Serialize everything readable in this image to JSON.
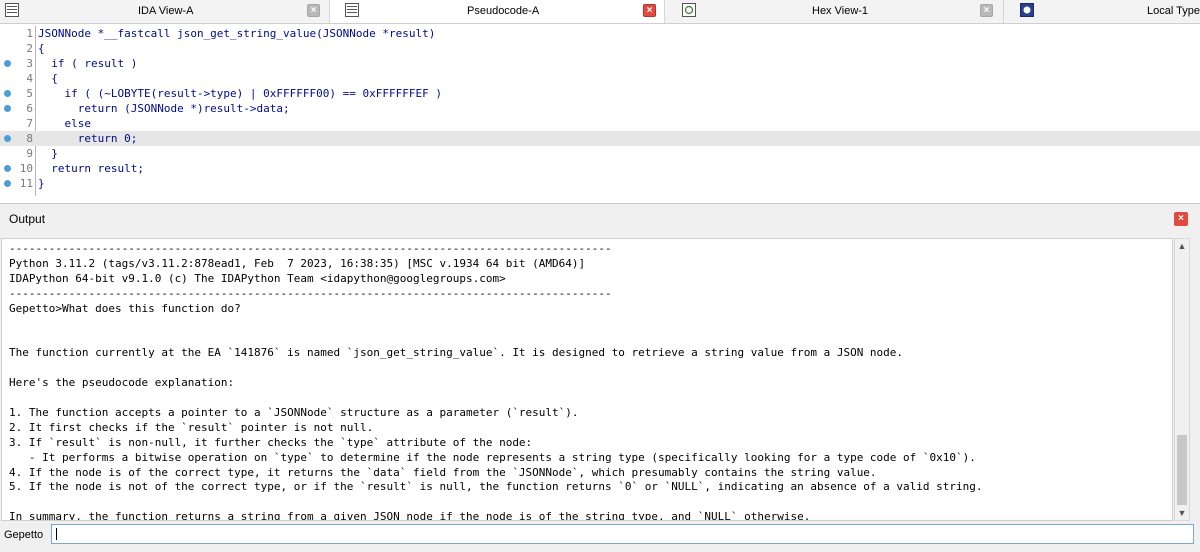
{
  "tabs": [
    {
      "label": "IDA View-A",
      "icon": "disassembly-icon",
      "active": false
    },
    {
      "label": "Pseudocode-A",
      "icon": "pseudocode-icon",
      "active": true
    },
    {
      "label": "Hex View-1",
      "icon": "hex-view-icon",
      "active": false
    },
    {
      "label": "Local Types",
      "icon": "local-types-icon",
      "active": false
    }
  ],
  "tab_close_glyph": "×",
  "code": {
    "lines": [
      {
        "num": "1",
        "breakpoint": false,
        "text": "JSONNode *__fastcall json_get_string_value(JSONNode *result)"
      },
      {
        "num": "2",
        "breakpoint": false,
        "text": "{"
      },
      {
        "num": "3",
        "breakpoint": true,
        "text": "  if ( result )"
      },
      {
        "num": "4",
        "breakpoint": false,
        "text": "  {"
      },
      {
        "num": "5",
        "breakpoint": true,
        "text": "    if ( (~LOBYTE(result->type) | 0xFFFFFF00) == 0xFFFFFFEF )"
      },
      {
        "num": "6",
        "breakpoint": true,
        "text": "      return (JSONNode *)result->data;"
      },
      {
        "num": "7",
        "breakpoint": false,
        "text": "    else"
      },
      {
        "num": "8",
        "breakpoint": true,
        "text": "      return 0;"
      },
      {
        "num": "9",
        "breakpoint": false,
        "text": "  }"
      },
      {
        "num": "10",
        "breakpoint": true,
        "text": "  return result;"
      },
      {
        "num": "11",
        "breakpoint": true,
        "text": "}"
      }
    ],
    "highlighted_line": "8"
  },
  "output": {
    "title": "Output",
    "close_glyph": "×",
    "lines": [
      "-------------------------------------------------------------------------------------------",
      "Python 3.11.2 (tags/v3.11.2:878ead1, Feb  7 2023, 16:38:35) [MSC v.1934 64 bit (AMD64)]",
      "IDAPython 64-bit v9.1.0 (c) The IDAPython Team <idapython@googlegroups.com>",
      "-------------------------------------------------------------------------------------------",
      "Gepetto>What does this function do?",
      "",
      "",
      "The function currently at the EA `141876` is named `json_get_string_value`. It is designed to retrieve a string value from a JSON node.",
      "",
      "Here's the pseudocode explanation:",
      "",
      "1. The function accepts a pointer to a `JSONNode` structure as a parameter (`result`).",
      "2. It first checks if the `result` pointer is not null.",
      "3. If `result` is non-null, it further checks the `type` attribute of the node:",
      "   - It performs a bitwise operation on `type` to determine if the node represents a string type (specifically looking for a type code of `0x10`).",
      "4. If the node is of the correct type, it returns the `data` field from the `JSONNode`, which presumably contains the string value.",
      "5. If the node is not of the correct type, or if the `result` is null, the function returns `0` or `NULL`, indicating an absence of a valid string.",
      "",
      "In summary, the function returns a string from a given JSON node if the node is of the string type, and `NULL` otherwise."
    ]
  },
  "cli": {
    "label": "Gepetto",
    "value": ""
  },
  "colors": {
    "accent_close": "#e04a3f",
    "breakpoint": "#4a9fd8",
    "code_keyword": "#000a8c"
  }
}
